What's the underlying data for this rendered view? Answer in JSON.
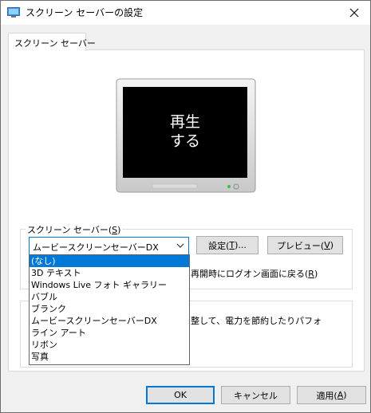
{
  "window": {
    "title": "スクリーン セーバーの設定"
  },
  "tab": {
    "label": "スクリーン セーバー"
  },
  "preview": {
    "line1": "再生",
    "line2": "する"
  },
  "screensaver_group": {
    "label_text": "スクリーン セーバー(",
    "label_key": "S",
    "label_end": ")",
    "selected": "ムービースクリーンセーバーDX",
    "settings_text": "設定(",
    "settings_key": "T",
    "settings_end": ")...",
    "preview_text": "プレビュー(",
    "preview_key": "V",
    "preview_end": ")",
    "resume_text_partial": "再開時にログオン画面に戻る(",
    "resume_key": "R",
    "resume_end": ")"
  },
  "dropdown": {
    "options": [
      "(なし)",
      "3D テキスト",
      "Windows Live フォト ギャラリー",
      "バブル",
      "ブランク",
      "ムービースクリーンセーバーDX",
      "ライン アート",
      "リボン",
      "写真"
    ],
    "highlighted_index": 0
  },
  "power": {
    "text_partial": "整して、電力を節約したりパフォ"
  },
  "buttons": {
    "ok": "OK",
    "cancel": "キャンセル",
    "apply_text": "適用(",
    "apply_key": "A",
    "apply_end": ")"
  },
  "colors": {
    "accent": "#0078d7",
    "screen": "#000000"
  }
}
